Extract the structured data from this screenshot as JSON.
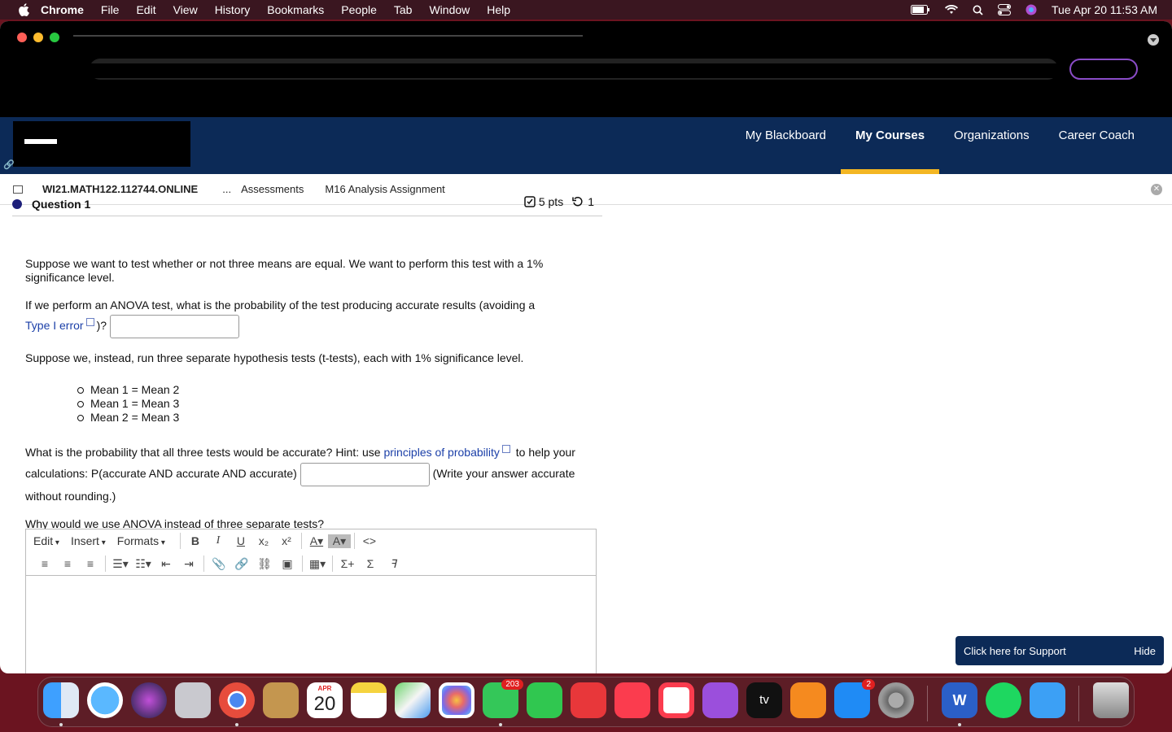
{
  "menubar": {
    "app": "Chrome",
    "items": [
      "File",
      "Edit",
      "View",
      "History",
      "Bookmarks",
      "People",
      "Tab",
      "Window",
      "Help"
    ],
    "clock": "Tue Apr 20  11:53 AM"
  },
  "nav": {
    "items": [
      "My Blackboard",
      "My Courses",
      "Organizations",
      "Career Coach"
    ],
    "active": "My Courses"
  },
  "breadcrumb": {
    "course": "WI21.MATH122.112744.ONLINE",
    "ellipsis": "...",
    "section": "Assessments",
    "page": "M16 Analysis Assignment"
  },
  "question": {
    "title": "Question 1",
    "points": "5 pts",
    "attempts": "1",
    "p1": "Suppose we want to test whether or not three means are equal. We want to perform this test with a 1% significance level.",
    "p2_before": "If we perform an ANOVA test, what is the probability of the test producing accurate results (avoiding a",
    "p2_link": "Type I error",
    "p2_after": ")?",
    "p3": "Suppose we, instead, run three separate hypothesis tests (t-tests), each with 1% significance level.",
    "bullets": [
      "Mean 1 = Mean 2",
      "Mean 1 = Mean 3",
      "Mean 2 = Mean 3"
    ],
    "p4_before": "What is the probability that all three tests would be accurate? Hint: use",
    "p4_link": "principles of probability",
    "p4_mid": "to help your calculations: P(accurate AND accurate AND accurate)",
    "p4_after": "(Write your answer accurate without rounding.)",
    "p5": "Why would we use ANOVA instead of three separate tests?"
  },
  "editor": {
    "menus": [
      "Edit",
      "Insert",
      "Formats"
    ]
  },
  "support": {
    "label": "Click here for Support",
    "hide": "Hide"
  },
  "dock": {
    "calendar_month": "APR",
    "calendar_day": "20",
    "messages_badge": "203",
    "appstore_badge": "2"
  }
}
